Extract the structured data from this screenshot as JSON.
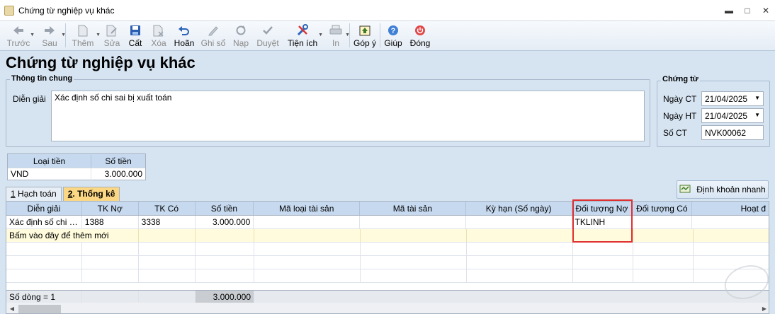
{
  "window": {
    "title": "Chứng từ nghiệp vụ khác",
    "controls": {
      "minimize": "▬",
      "maximize": "□",
      "close": "✕"
    }
  },
  "toolbar": {
    "items": [
      {
        "label": "Trước",
        "icon": "arrow-left-icon",
        "disabled": true
      },
      {
        "label": "Sau",
        "icon": "arrow-right-icon",
        "disabled": true
      },
      {
        "label": "Thêm",
        "icon": "new-document-icon",
        "disabled": true
      },
      {
        "label": "Sửa",
        "icon": "edit-document-icon",
        "disabled": true
      },
      {
        "label": "Cất",
        "icon": "save-icon",
        "disabled": false
      },
      {
        "label": "Xóa",
        "icon": "delete-document-icon",
        "disabled": true
      },
      {
        "label": "Hoãn",
        "icon": "undo-icon",
        "disabled": false
      },
      {
        "label": "Ghi sổ",
        "icon": "pencil-icon",
        "disabled": true
      },
      {
        "label": "Nạp",
        "icon": "refresh-icon",
        "disabled": true
      },
      {
        "label": "Duyệt",
        "icon": "checkmark-icon",
        "disabled": true
      },
      {
        "label": "Tiện ích",
        "icon": "tools-icon",
        "disabled": false
      },
      {
        "label": "In",
        "icon": "printer-icon",
        "disabled": true
      },
      {
        "label": "Góp ý",
        "icon": "feedback-icon",
        "disabled": false
      },
      {
        "label": "Giúp",
        "icon": "help-icon",
        "disabled": false
      },
      {
        "label": "Đóng",
        "icon": "power-icon",
        "disabled": false
      }
    ]
  },
  "page_title": "Chứng từ nghiệp vụ khác",
  "general_info": {
    "group_label": "Thông tin chung",
    "description_label": "Diễn giải",
    "description_value": "Xác định số chi sai bị xuất toán"
  },
  "voucher": {
    "group_label": "Chứng từ",
    "date_label": "Ngày CT",
    "date_value": "21/04/2025",
    "post_date_label": "Ngày HT",
    "post_date_value": "21/04/2025",
    "number_label": "Số CT",
    "number_value": "NVK00062"
  },
  "currency": {
    "headers": [
      "Loại tiền",
      "Số tiền"
    ],
    "row": [
      "VND",
      "3.000.000"
    ]
  },
  "tabs": [
    {
      "key": "1",
      "label": " Hạch toán",
      "active": false
    },
    {
      "key": "2",
      "label": ". Thống kê",
      "active": true
    }
  ],
  "quick_button": "Định khoản nhanh",
  "grid": {
    "headers": [
      "Diễn giải",
      "TK Nợ",
      "TK Có",
      "Số tiền",
      "Mã loại tài sản",
      "Mã tài sản",
      "Kỳ hạn (Số ngày)",
      "Đối tượng Nợ",
      "Đối tượng Có",
      "Hoạt đ"
    ],
    "rows": [
      [
        "Xác định số chi sa...",
        "1388",
        "3338",
        "3.000.000",
        "",
        "",
        "",
        "TKLINH",
        "",
        ""
      ]
    ],
    "new_row_hint": "Bấm vào đây để thêm mới",
    "footer_count": "Số dòng = 1",
    "footer_total": "3.000.000"
  },
  "colors": {
    "highlight_box": "#e03030",
    "active_tab": "#fbd784",
    "header_bg": "#c6d9ef"
  }
}
